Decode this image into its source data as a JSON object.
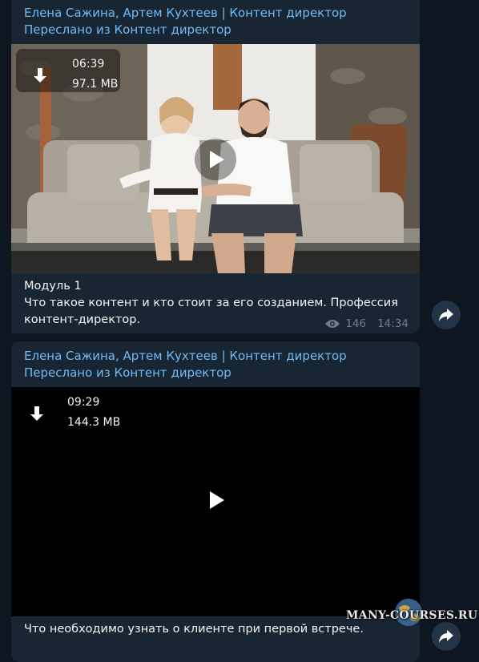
{
  "messages": [
    {
      "author": "Елена Сажина, Артем Кухтеев | Контент директор",
      "forwarded": "Переслано из Контент директор",
      "video": {
        "duration": "06:39",
        "size": "97.1 MB"
      },
      "caption_lines": [
        "Модуль 1",
        "Что такое контент и кто стоит за его созданием. Профессия",
        "контент-директор."
      ],
      "views": "146",
      "time": "14:34"
    },
    {
      "author": "Елена Сажина, Артем Кухтеев | Контент директор",
      "forwarded": "Переслано из Контент директор",
      "video": {
        "duration": "09:29",
        "size": "144.3 MB"
      },
      "caption_lines": [
        "Что необходимо узнать о клиенте при первой встрече."
      ]
    }
  ],
  "watermark": "MANY-COURSES.RU",
  "icons": [
    "download-icon",
    "play-icon",
    "eye-icon",
    "share-icon"
  ],
  "colors": {
    "background": "#0e1621",
    "bubble": "#182533",
    "link": "#71baf3",
    "meta": "#6d7f8f"
  }
}
